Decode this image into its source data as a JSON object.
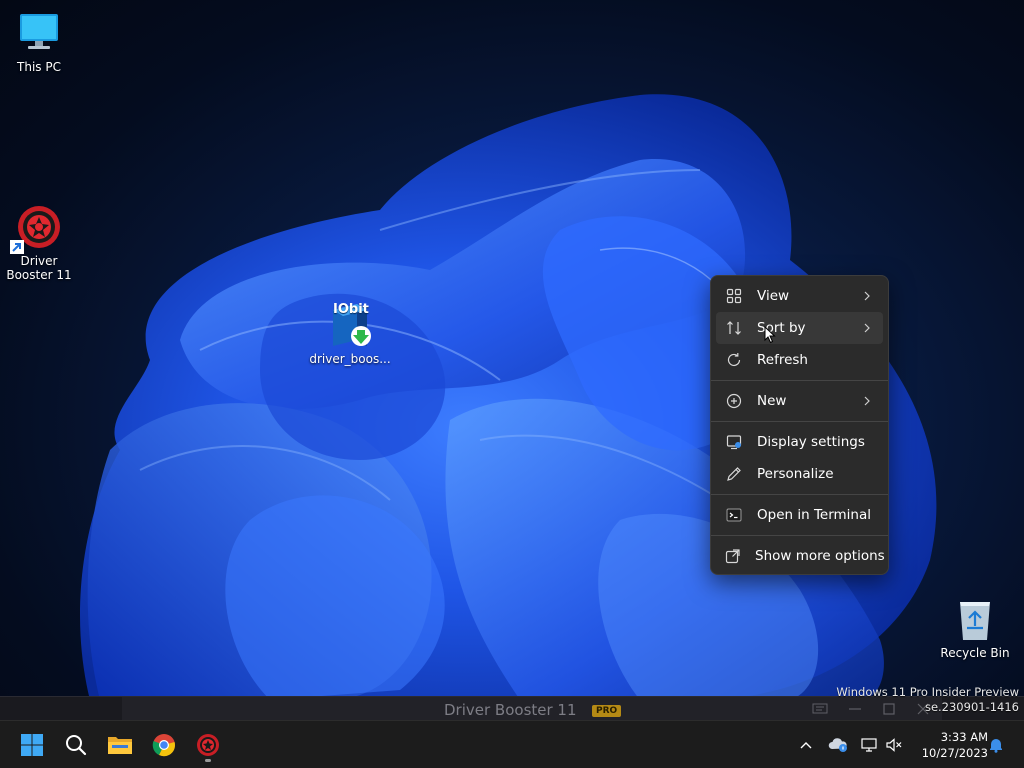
{
  "desktop": {
    "icons": [
      {
        "label": "This PC",
        "icon": "computer-icon"
      },
      {
        "label": "Driver Booster 11",
        "icon": "driver-booster-icon"
      },
      {
        "label": "driver_boos...",
        "icon": "iobit-installer-icon",
        "brand_text": "IObit"
      },
      {
        "label": "Recycle Bin",
        "icon": "recycle-bin-icon"
      }
    ]
  },
  "context_menu": {
    "items": [
      {
        "label": "View",
        "icon": "grid-icon",
        "submenu": true
      },
      {
        "label": "Sort by",
        "icon": "sort-icon",
        "submenu": true
      },
      {
        "label": "Refresh",
        "icon": "refresh-icon",
        "submenu": false
      },
      {
        "label": "New",
        "icon": "plus-circle-icon",
        "submenu": true
      },
      {
        "label": "Display settings",
        "icon": "display-icon",
        "submenu": false
      },
      {
        "label": "Personalize",
        "icon": "pen-icon",
        "submenu": false
      },
      {
        "label": "Open in Terminal",
        "icon": "terminal-icon",
        "submenu": false
      },
      {
        "label": "Show more options",
        "icon": "share-icon",
        "submenu": false
      }
    ]
  },
  "background_window": {
    "title": "Driver Booster 11",
    "badge": "PRO"
  },
  "watermark": {
    "line1": "Windows 11 Pro Insider Preview",
    "line2": "se.230901-1416"
  },
  "taskbar": {
    "apps": [
      {
        "name": "Start",
        "icon": "windows-start-icon"
      },
      {
        "name": "Search",
        "icon": "search-icon"
      },
      {
        "name": "File Explorer",
        "icon": "folder-icon"
      },
      {
        "name": "Google Chrome",
        "icon": "chrome-icon"
      },
      {
        "name": "Driver Booster",
        "icon": "driver-booster-icon"
      }
    ],
    "clock": {
      "time": "3:33 AM",
      "date": "10/27/2023"
    }
  },
  "colors": {
    "menu_bg": "#2b2b2b",
    "taskbar_bg": "#1c1c1c",
    "accent": "#0078d4",
    "driver_booster_red": "#d8232a"
  }
}
